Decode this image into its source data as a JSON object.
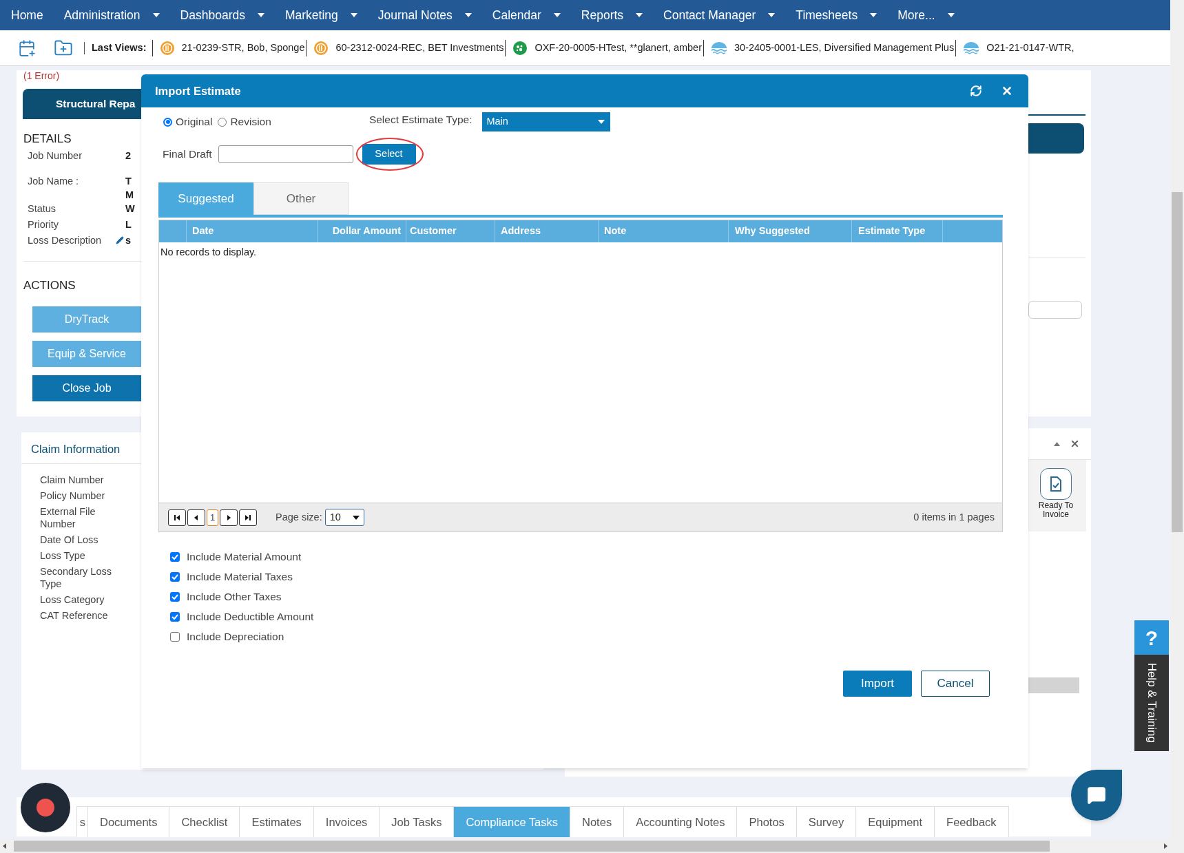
{
  "nav": [
    {
      "label": "Home",
      "dropdown": false
    },
    {
      "label": "Administration",
      "dropdown": true
    },
    {
      "label": "Dashboards",
      "dropdown": true
    },
    {
      "label": "Marketing",
      "dropdown": true
    },
    {
      "label": "Journal Notes",
      "dropdown": true
    },
    {
      "label": "Calendar",
      "dropdown": true
    },
    {
      "label": "Reports",
      "dropdown": true
    },
    {
      "label": "Contact Manager",
      "dropdown": true
    },
    {
      "label": "Timesheets",
      "dropdown": true
    },
    {
      "label": "More...",
      "dropdown": true
    }
  ],
  "last_views": {
    "label": "Last Views:",
    "items": [
      {
        "kind": "coin",
        "label": "21-0239-STR, Bob, Sponge"
      },
      {
        "kind": "coin",
        "label": "60-2312-0024-REC, BET Investments"
      },
      {
        "kind": "mold",
        "label": "OXF-20-0005-HTest, **glanert, amber"
      },
      {
        "kind": "water",
        "label": "30-2405-0001-LES, Diversified Management Plus"
      },
      {
        "kind": "water",
        "label": "O21-21-0147-WTR,"
      }
    ]
  },
  "job_card": {
    "error": "(1 Error)",
    "title": "Structural Repa",
    "details_heading": "DETAILS",
    "fields": [
      {
        "label": "Job Number",
        "values": [
          "2"
        ],
        "editable": false
      },
      {
        "label": "Job Name :",
        "values": [
          "T",
          "M"
        ],
        "editable": false
      },
      {
        "label": "Status",
        "values": [
          "W"
        ],
        "editable": false
      },
      {
        "label": "Priority",
        "values": [
          "L"
        ],
        "editable": false
      },
      {
        "label": "Loss Description",
        "values": [
          "s"
        ],
        "editable": true
      }
    ],
    "actions_heading": "ACTIONS",
    "actions": [
      {
        "label": "DryTrack",
        "kind": "light"
      },
      {
        "label": "Equip & Service",
        "kind": "light"
      },
      {
        "label": "Close Job",
        "kind": "dark"
      }
    ]
  },
  "claim_card": {
    "title": "Claim Information",
    "fields": [
      "Claim Number",
      "Policy Number",
      "External File Number",
      "Date Of Loss",
      "Loss Type",
      "Secondary Loss Type",
      "Loss Category",
      "CAT Reference"
    ]
  },
  "widget_panel": {
    "items": [
      {
        "label": "Ready To Invoice"
      }
    ]
  },
  "dialog": {
    "title": "Import Estimate",
    "versions": [
      {
        "label": "Original",
        "selected": true
      },
      {
        "label": "Revision",
        "selected": false
      }
    ],
    "estimate_type": {
      "label": "Select Estimate Type:",
      "value": "Main"
    },
    "final_draft": {
      "label": "Final Draft",
      "button": "Select",
      "highlighted": true
    },
    "tabs": [
      {
        "label": "Suggested",
        "selected": true
      },
      {
        "label": "Other",
        "selected": false
      }
    ],
    "table": {
      "columns": [
        "Date",
        "Dollar Amount",
        "Customer",
        "Address",
        "Note",
        "Why Suggested",
        "Estimate Type"
      ],
      "empty_text": "No records to display."
    },
    "pager": {
      "page": "1",
      "page_size_label": "Page size:",
      "page_size": "10",
      "info": "0 items in 1 pages"
    },
    "options": [
      {
        "label": "Include Material Amount",
        "checked": true
      },
      {
        "label": "Include Material Taxes",
        "checked": true
      },
      {
        "label": "Include Other Taxes",
        "checked": true
      },
      {
        "label": "Include Deductible Amount",
        "checked": true
      },
      {
        "label": "Include Depreciation",
        "checked": false
      }
    ],
    "buttons": [
      {
        "label": "Import",
        "kind": "primary"
      },
      {
        "label": "Cancel",
        "kind": "secondary"
      }
    ]
  },
  "bottom_tabs": [
    {
      "label": "s",
      "selected": false
    },
    {
      "label": "Documents",
      "selected": false
    },
    {
      "label": "Checklist",
      "selected": false
    },
    {
      "label": "Estimates",
      "selected": false
    },
    {
      "label": "Invoices",
      "selected": false
    },
    {
      "label": "Job Tasks",
      "selected": false
    },
    {
      "label": "Compliance Tasks",
      "selected": true
    },
    {
      "label": "Notes",
      "selected": false
    },
    {
      "label": "Accounting Notes",
      "selected": false
    },
    {
      "label": "Photos",
      "selected": false
    },
    {
      "label": "Survey",
      "selected": false
    },
    {
      "label": "Equipment",
      "selected": false
    },
    {
      "label": "Feedback",
      "selected": false
    }
  ],
  "help_tab": {
    "icon_text": "?",
    "label": "Help & Training"
  }
}
